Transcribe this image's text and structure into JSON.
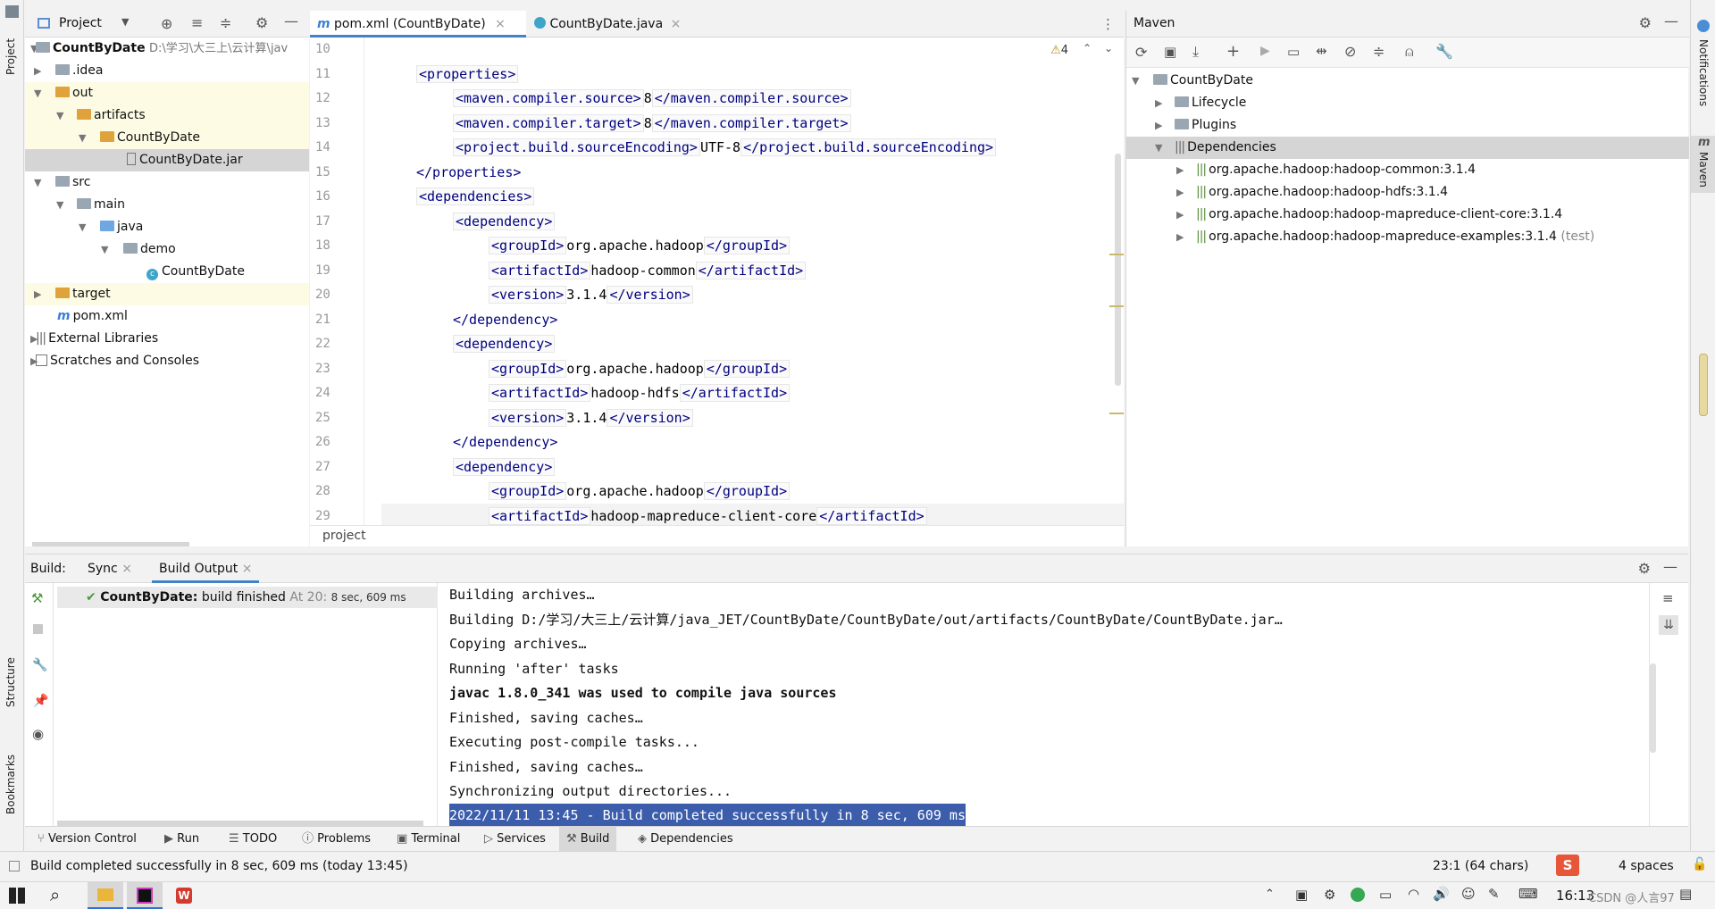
{
  "left_strip": {
    "project": "Project",
    "structure": "Structure",
    "bookmarks": "Bookmarks"
  },
  "right_strip": {
    "notifications": "Notifications",
    "maven": "Maven"
  },
  "project_panel": {
    "title": "Project",
    "items": [
      {
        "label": "CountByDate",
        "path": "D:\\学习\\大三上\\云计算\\jav"
      },
      {
        "label": ".idea"
      },
      {
        "label": "out"
      },
      {
        "label": "artifacts"
      },
      {
        "label": "CountByDate"
      },
      {
        "label": "CountByDate.jar"
      },
      {
        "label": "src"
      },
      {
        "label": "main"
      },
      {
        "label": "java"
      },
      {
        "label": "demo"
      },
      {
        "label": "CountByDate"
      },
      {
        "label": "target"
      },
      {
        "label": "pom.xml"
      },
      {
        "label": "External Libraries"
      },
      {
        "label": "Scratches and Consoles"
      }
    ]
  },
  "editor": {
    "tabs": [
      {
        "label": "pom.xml (CountByDate)",
        "icon": "m"
      },
      {
        "label": "CountByDate.java",
        "icon": "c"
      }
    ],
    "warning_count": "4",
    "breadcrumb": "project",
    "line_numbers": [
      "10",
      "11",
      "12",
      "13",
      "14",
      "15",
      "16",
      "17",
      "18",
      "19",
      "20",
      "21",
      "22",
      "23",
      "24",
      "25",
      "26",
      "27",
      "28",
      "29"
    ],
    "lines": [
      {
        "open": "<maven.compiler.source>",
        "text": "8",
        "close": "</maven.compiler.source>"
      },
      {
        "open": "<maven.compiler.target>",
        "text": "8",
        "close": "</maven.compiler.target>"
      },
      {
        "open": "<project.build.sourceEncoding>",
        "text": "UTF-8",
        "close": "</project.build.sourceEncoding>"
      },
      {
        "open": "<groupId>",
        "text": "org.apache.hadoop",
        "close": "</groupId>"
      },
      {
        "open": "<artifactId>",
        "text": "hadoop-common",
        "close": "</artifactId>"
      },
      {
        "open": "<version>",
        "text": "3.1.4",
        "close": "</version>"
      },
      {
        "open": "<groupId>",
        "text": "org.apache.hadoop",
        "close": "</groupId>"
      },
      {
        "open": "<artifactId>",
        "text": "hadoop-hdfs",
        "close": "</artifactId>"
      },
      {
        "open": "<version>",
        "text": "3.1.4",
        "close": "</version>"
      },
      {
        "open": "<groupId>",
        "text": "org.apache.hadoop",
        "close": "</groupId>"
      },
      {
        "open": "<artifactId>",
        "text": "hadoop-mapreduce-client-core",
        "close": "</artifactId>"
      }
    ],
    "tags": {
      "properties_open": "<properties>",
      "properties_close": "</properties>",
      "dependencies_open": "<dependencies>",
      "dependency_open": "<dependency>",
      "dependency_close": "</dependency>"
    }
  },
  "maven_panel": {
    "title": "Maven",
    "root": "CountByDate",
    "items": [
      {
        "label": "Lifecycle"
      },
      {
        "label": "Plugins"
      },
      {
        "label": "Dependencies"
      },
      {
        "label": "org.apache.hadoop:hadoop-common:3.1.4"
      },
      {
        "label": "org.apache.hadoop:hadoop-hdfs:3.1.4"
      },
      {
        "label": "org.apache.hadoop:hadoop-mapreduce-client-core:3.1.4"
      },
      {
        "label": "org.apache.hadoop:hadoop-mapreduce-examples:3.1.4",
        "suffix": "(test)"
      }
    ]
  },
  "build_panel": {
    "title": "Build:",
    "tabs": [
      {
        "label": "Sync"
      },
      {
        "label": "Build Output"
      }
    ],
    "tree_item": {
      "name": "CountByDate:",
      "status": "build finished",
      "at": "At 20:",
      "time": "8 sec, 609 ms"
    },
    "output": [
      "Building archives…",
      "Building D:/学习/大三上/云计算/java_JET/CountByDate/CountByDate/out/artifacts/CountByDate/CountByDate.jar…",
      "Copying archives…",
      "Running 'after' tasks",
      "javac 1.8.0_341 was used to compile java sources",
      "Finished, saving caches…",
      "Executing post-compile tasks...",
      "Finished, saving caches…",
      "Synchronizing output directories...",
      "2022/11/11 13:45 - Build completed successfully in 8 sec, 609 ms"
    ]
  },
  "bottom_tabs": [
    {
      "label": "Version Control"
    },
    {
      "label": "Run"
    },
    {
      "label": "TODO"
    },
    {
      "label": "Problems"
    },
    {
      "label": "Terminal"
    },
    {
      "label": "Services"
    },
    {
      "label": "Build"
    },
    {
      "label": "Dependencies"
    }
  ],
  "status_bar": {
    "message": "Build completed successfully in 8 sec, 609 ms (today 13:45)",
    "position": "23:1 (64 chars)",
    "indent": "4 spaces"
  },
  "taskbar": {
    "time": "16:13",
    "watermark": "CSDN @人言97"
  }
}
